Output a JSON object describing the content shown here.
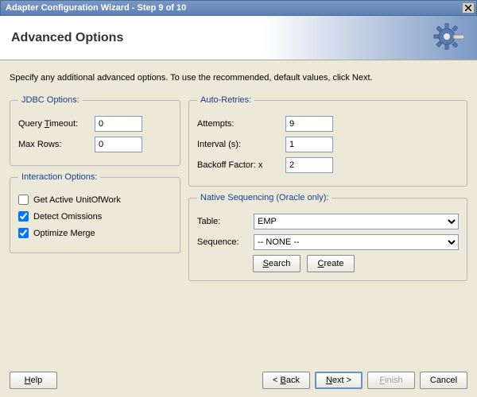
{
  "titlebar": "Adapter Configuration Wizard - Step 9 of 10",
  "header": {
    "title": "Advanced Options"
  },
  "instruction": "Specify any additional advanced options.  To use the recommended, default values, click Next.",
  "jdbc": {
    "legend": "JDBC Options:",
    "query_timeout_label_pre": "Query ",
    "query_timeout_label_key": "T",
    "query_timeout_label_post": "imeout:",
    "query_timeout_value": "0",
    "max_rows_label": "Max Rows:",
    "max_rows_value": "0"
  },
  "retries": {
    "legend": "Auto-Retries:",
    "attempts_label": "Attempts:",
    "attempts_value": "9",
    "interval_label": "Interval (s):",
    "interval_value": "1",
    "backoff_label": "Backoff Factor: x",
    "backoff_value": "2"
  },
  "interaction": {
    "legend": "Interaction Options:",
    "get_active_label": "Get Active UnitOfWork",
    "detect_label": "Detect Omissions",
    "optimize_label": "Optimize Merge"
  },
  "sequencing": {
    "legend": "Native Sequencing (Oracle only):",
    "table_label": "Table:",
    "table_value": "EMP",
    "sequence_label": "Sequence:",
    "sequence_value": "-- NONE --",
    "search_pre": "",
    "search_key": "S",
    "search_post": "earch",
    "create_pre": "",
    "create_key": "C",
    "create_post": "reate"
  },
  "footer": {
    "help_pre": "",
    "help_key": "H",
    "help_post": "elp",
    "back_pre": "< ",
    "back_key": "B",
    "back_post": "ack",
    "next_pre": "",
    "next_key": "N",
    "next_post": "ext >",
    "finish_pre": "",
    "finish_key": "F",
    "finish_post": "inish",
    "cancel": "Cancel"
  }
}
